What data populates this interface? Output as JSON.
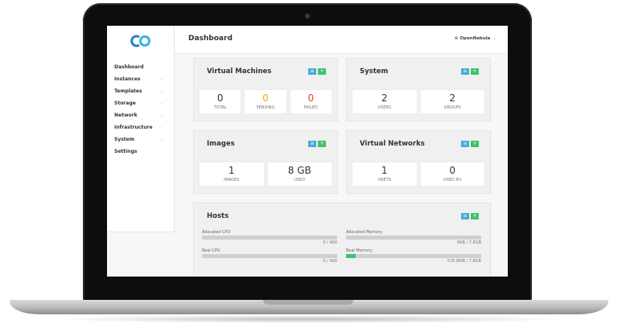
{
  "app": {
    "user": "OpenNebula"
  },
  "header": {
    "title": "Dashboard"
  },
  "sidebar": {
    "items": [
      {
        "label": "Dashboard",
        "chevron": false
      },
      {
        "label": "Instances",
        "chevron": true
      },
      {
        "label": "Templates",
        "chevron": true
      },
      {
        "label": "Storage",
        "chevron": true
      },
      {
        "label": "Network",
        "chevron": true
      },
      {
        "label": "Infrastructure",
        "chevron": true
      },
      {
        "label": "System",
        "chevron": true
      },
      {
        "label": "Settings",
        "chevron": false
      }
    ]
  },
  "panels": {
    "vms": {
      "title": "Virtual Machines",
      "stats": [
        {
          "value": "0",
          "label": "TOTAL"
        },
        {
          "value": "0",
          "label": "PENDING"
        },
        {
          "value": "0",
          "label": "FAILED"
        }
      ]
    },
    "system": {
      "title": "System",
      "stats": [
        {
          "value": "2",
          "label": "USERS"
        },
        {
          "value": "2",
          "label": "GROUPS"
        }
      ]
    },
    "images": {
      "title": "Images",
      "stats": [
        {
          "value": "1",
          "label": "IMAGES"
        },
        {
          "value": "8 GB",
          "label": "USED"
        }
      ]
    },
    "vnets": {
      "title": "Virtual Networks",
      "stats": [
        {
          "value": "1",
          "label": "VNETS"
        },
        {
          "value": "0",
          "label": "USED IPs"
        }
      ]
    },
    "hosts": {
      "title": "Hosts",
      "bars": [
        {
          "label": "Allocated CPU",
          "value": "0 / 400",
          "fraction": 0
        },
        {
          "label": "Real CPU",
          "value": "0 / 400",
          "fraction": 0
        },
        {
          "label": "Allocated Memory",
          "value": "0KB / 7.8GB",
          "fraction": 0
        },
        {
          "label": "Real Memory",
          "value": "576.8MB / 7.8GB",
          "fraction": 0.072
        }
      ]
    }
  },
  "colors": {
    "accent_blue": "#4aa8d8",
    "accent_green": "#3cc46a",
    "pending_orange": "#f5a623",
    "failed_red": "#e8452c"
  },
  "icons": {
    "logo": "opennebula-logo-icon",
    "user": "globe-icon",
    "list_button": "list-icon",
    "add_button": "plus-icon"
  }
}
